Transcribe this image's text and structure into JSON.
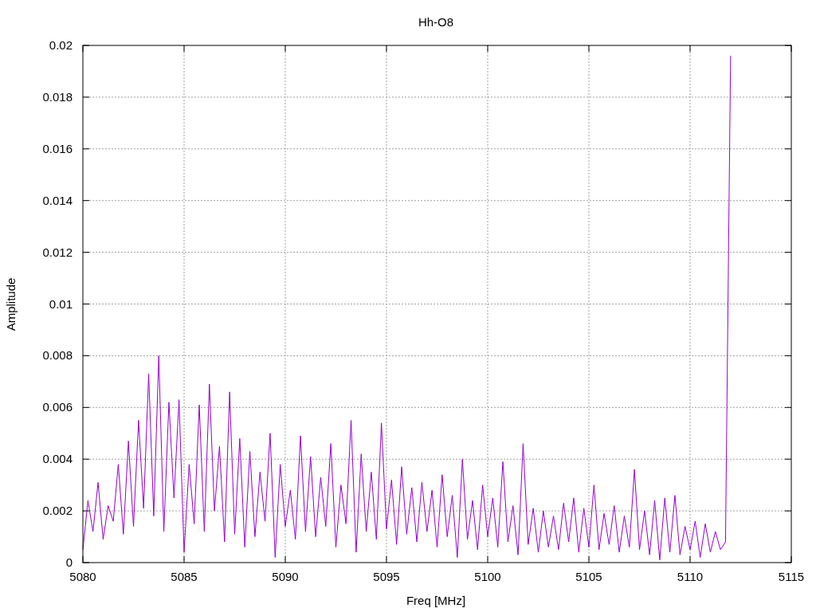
{
  "chart_data": {
    "type": "line",
    "title": "Hh-O8",
    "xlabel": "Freq [MHz]",
    "ylabel": "Amplitude",
    "grid": true,
    "xlim": [
      5080,
      5115
    ],
    "ylim": [
      0,
      0.02
    ],
    "xticks": [
      5080,
      5085,
      5090,
      5095,
      5100,
      5105,
      5110,
      5115
    ],
    "yticks": [
      0,
      0.002,
      0.004,
      0.006,
      0.008,
      0.01,
      0.012,
      0.014,
      0.016,
      0.018,
      0.02
    ],
    "x": [
      5080,
      5080.25,
      5080.5,
      5080.75,
      5081,
      5081.25,
      5081.5,
      5081.75,
      5082,
      5082.25,
      5082.5,
      5082.75,
      5083,
      5083.25,
      5083.5,
      5083.75,
      5084,
      5084.25,
      5084.5,
      5084.75,
      5085,
      5085.25,
      5085.5,
      5085.75,
      5086,
      5086.25,
      5086.5,
      5086.75,
      5087,
      5087.25,
      5087.5,
      5087.75,
      5088,
      5088.25,
      5088.5,
      5088.75,
      5089,
      5089.25,
      5089.5,
      5089.75,
      5090,
      5090.25,
      5090.5,
      5090.75,
      5091,
      5091.25,
      5091.5,
      5091.75,
      5092,
      5092.25,
      5092.5,
      5092.75,
      5093,
      5093.25,
      5093.5,
      5093.75,
      5094,
      5094.25,
      5094.5,
      5094.75,
      5095,
      5095.25,
      5095.5,
      5095.75,
      5096,
      5096.25,
      5096.5,
      5096.75,
      5097,
      5097.25,
      5097.5,
      5097.75,
      5098,
      5098.25,
      5098.5,
      5098.75,
      5099,
      5099.25,
      5099.5,
      5099.75,
      5100,
      5100.25,
      5100.5,
      5100.75,
      5101,
      5101.25,
      5101.5,
      5101.75,
      5102,
      5102.25,
      5102.5,
      5102.75,
      5103,
      5103.25,
      5103.5,
      5103.75,
      5104,
      5104.25,
      5104.5,
      5104.75,
      5105,
      5105.25,
      5105.5,
      5105.75,
      5106,
      5106.25,
      5106.5,
      5106.75,
      5107,
      5107.25,
      5107.5,
      5107.75,
      5108,
      5108.25,
      5108.5,
      5108.75,
      5109,
      5109.25,
      5109.5,
      5109.75,
      5110,
      5110.25,
      5110.5,
      5110.75,
      5111,
      5111.25,
      5111.5,
      5111.75,
      5112
    ],
    "series": [
      {
        "color": "#9400d3",
        "values": [
          0.0005,
          0.0024,
          0.0012,
          0.0031,
          0.0009,
          0.0022,
          0.0016,
          0.0038,
          0.0011,
          0.0047,
          0.0014,
          0.0055,
          0.0021,
          0.0073,
          0.0018,
          0.008,
          0.0012,
          0.0062,
          0.0025,
          0.0063,
          0.0004,
          0.0038,
          0.0015,
          0.0061,
          0.0012,
          0.0069,
          0.002,
          0.0045,
          0.0008,
          0.0066,
          0.0011,
          0.0048,
          0.0006,
          0.0043,
          0.001,
          0.0035,
          0.0016,
          0.005,
          0.0002,
          0.0038,
          0.0014,
          0.0028,
          0.0009,
          0.0049,
          0.0012,
          0.0041,
          0.001,
          0.0033,
          0.0014,
          0.0046,
          0.0006,
          0.003,
          0.0015,
          0.0055,
          0.0004,
          0.0042,
          0.0012,
          0.0035,
          0.0009,
          0.0054,
          0.0013,
          0.0032,
          0.0007,
          0.0037,
          0.0011,
          0.0029,
          0.0008,
          0.0031,
          0.0012,
          0.0028,
          0.0006,
          0.0034,
          0.001,
          0.0026,
          0.0002,
          0.004,
          0.0009,
          0.0024,
          0.0005,
          0.003,
          0.001,
          0.0025,
          0.0006,
          0.0039,
          0.0008,
          0.0022,
          0.0003,
          0.0046,
          0.0007,
          0.0021,
          0.0004,
          0.002,
          0.0006,
          0.0018,
          0.0005,
          0.0023,
          0.0008,
          0.0025,
          0.0004,
          0.0021,
          0.0006,
          0.003,
          0.0005,
          0.0019,
          0.0007,
          0.0022,
          0.0004,
          0.0018,
          0.0006,
          0.0036,
          0.0005,
          0.002,
          0.0003,
          0.0024,
          0.0001,
          0.0025,
          0.0004,
          0.0026,
          0.0003,
          0.0014,
          0.0005,
          0.0016,
          0.0002,
          0.0015,
          0.0004,
          0.0012,
          0.0005,
          0.0008,
          0.0196
        ]
      }
    ]
  }
}
